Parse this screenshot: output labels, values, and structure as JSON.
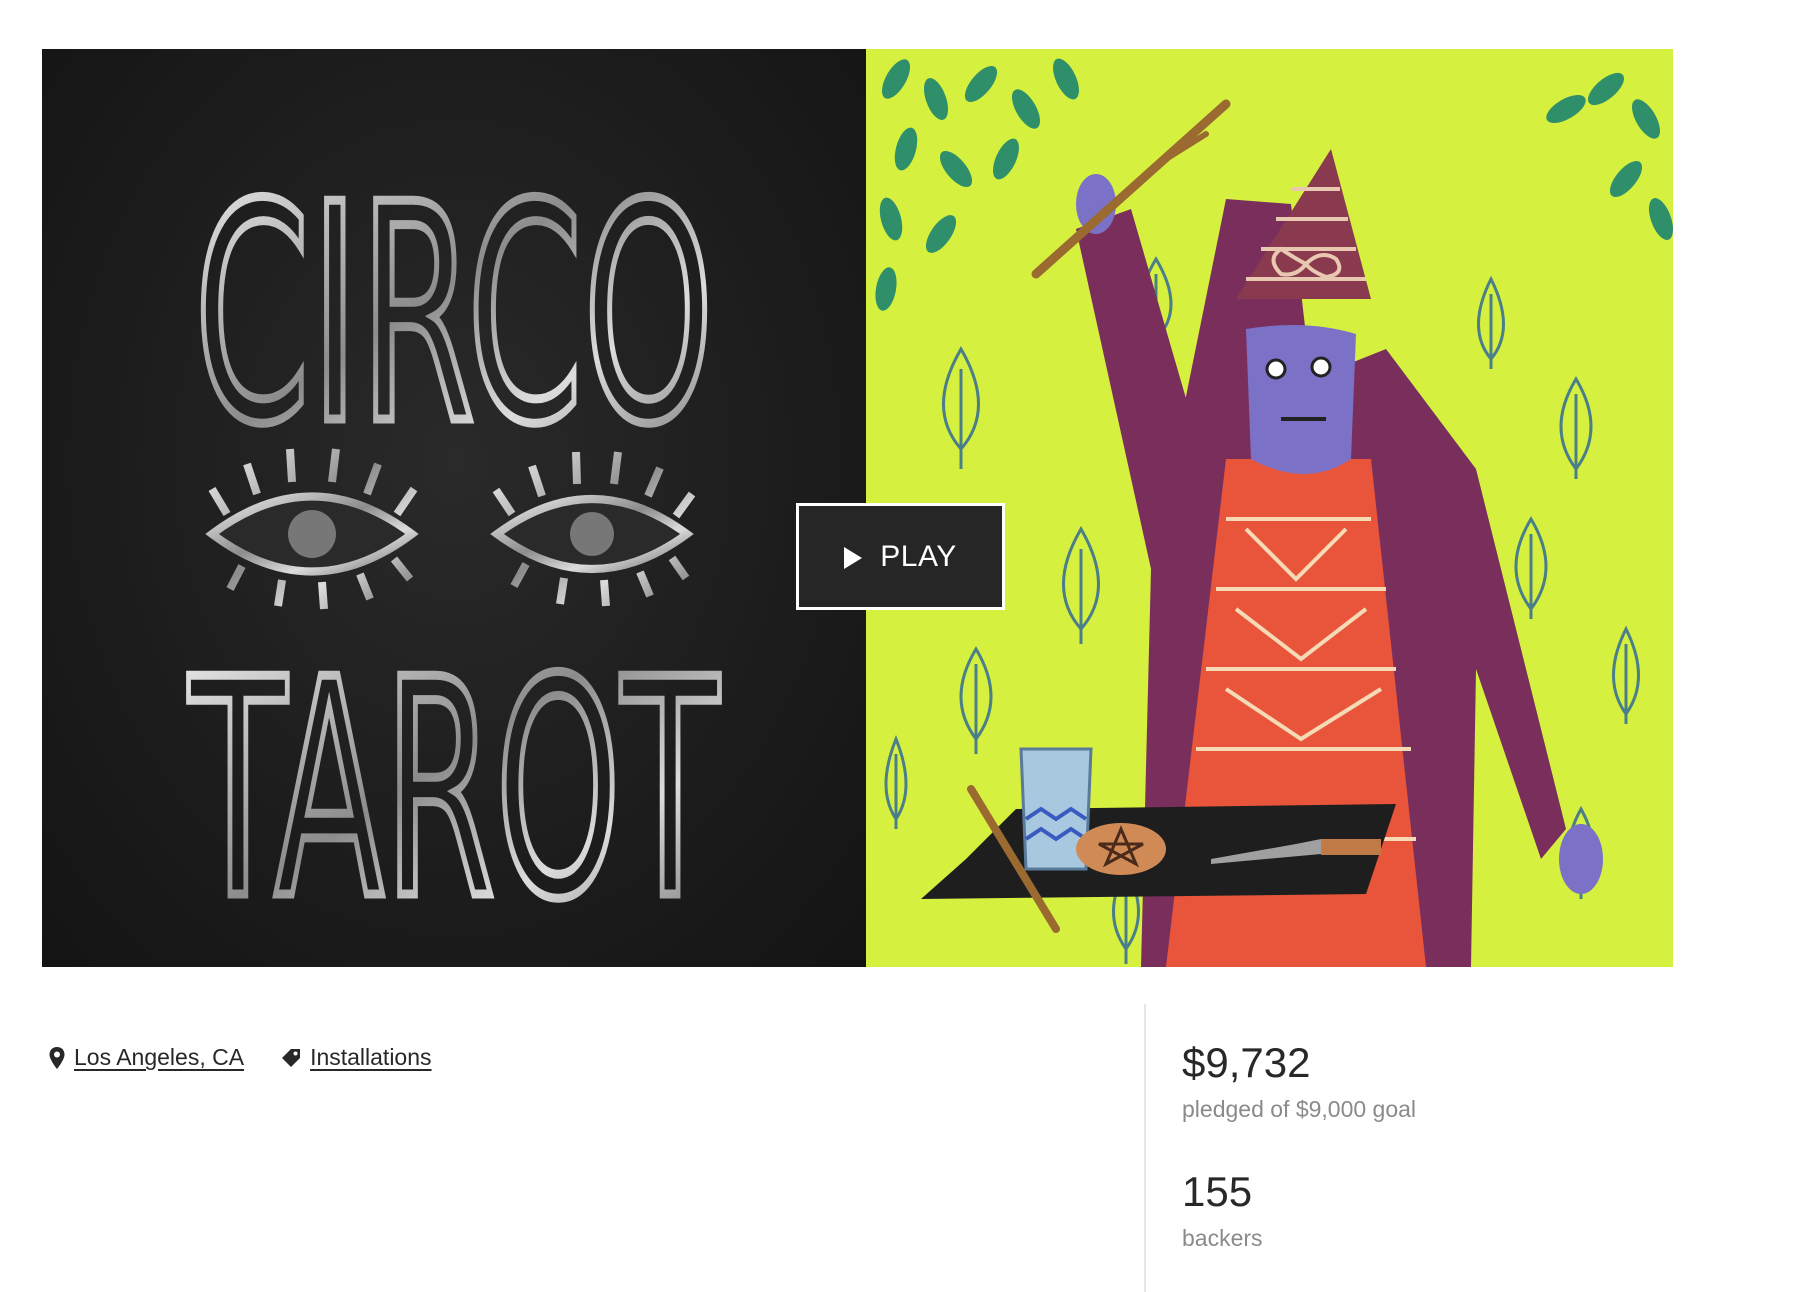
{
  "media": {
    "artwork_title_line1": "CIRCO",
    "artwork_title_line2": "TAROT",
    "play_label": "PLAY",
    "play_icon": "play-triangle-icon"
  },
  "meta": {
    "location": {
      "label": "Los Angeles, CA",
      "icon": "map-pin-icon"
    },
    "category": {
      "label": "Installations",
      "icon": "tag-icon"
    }
  },
  "stats": {
    "pledged": {
      "value": "$9,732",
      "label": "pledged of $9,000 goal"
    },
    "backers": {
      "value": "155",
      "label": "backers"
    }
  },
  "colors": {
    "dark_panel": "#1c1c1c",
    "lime_panel": "#d6f040",
    "robe": "#7a2e5c",
    "skin": "#7b72c8",
    "dress": "#e8553a",
    "leaf": "#2e8f6a"
  }
}
